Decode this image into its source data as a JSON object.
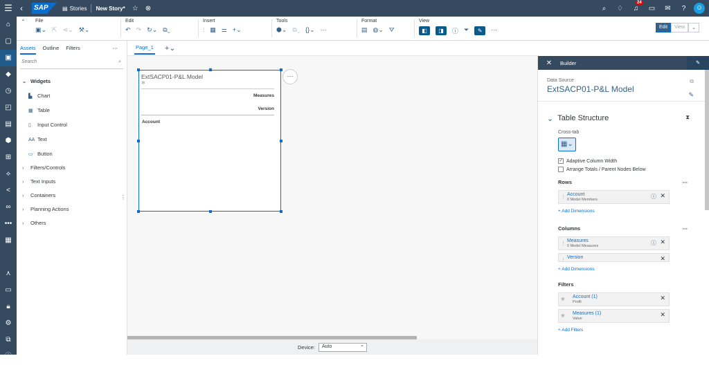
{
  "shell": {
    "logo": "SAP",
    "crumb_app": "Stories",
    "title": "New Story",
    "title_suffix": "*",
    "notification_count": "24"
  },
  "toolbar": {
    "groups": [
      {
        "label": "File"
      },
      {
        "label": "Edit"
      },
      {
        "label": "Insert"
      },
      {
        "label": "Tools"
      },
      {
        "label": "Format"
      },
      {
        "label": "View"
      }
    ],
    "mode_edit": "Edit",
    "mode_view": "View"
  },
  "assets": {
    "tabs": [
      "Assets",
      "Outline",
      "Filters"
    ],
    "search_placeholder": "Search",
    "widgets_label": "Widgets",
    "widgets": [
      "Chart",
      "Table",
      "Input Control",
      "Text",
      "Button"
    ],
    "groups": [
      "Filters/Controls",
      "Text Inputs",
      "Containers",
      "Planning Actions",
      "Others"
    ]
  },
  "canvas": {
    "page_tab": "Page_1",
    "widget_title": "ExtSACP01-P&L Model",
    "col_header_1": "Measures",
    "col_header_2": "Version",
    "row_header": "Account",
    "device_label": "Device:",
    "device_value": "Auto"
  },
  "builder": {
    "title": "Builder",
    "data_source_label": "Data Source",
    "data_source_value": "ExtSACP01-P&L Model",
    "table_structure": "Table Structure",
    "crosstab_label": "Cross-tab",
    "adaptive": "Adaptive Column Width",
    "arrange": "Arrange Totals / Parent Nodes Below",
    "rows_label": "Rows",
    "rows": [
      {
        "name": "Account",
        "sub": "0 Model Members"
      }
    ],
    "add_dimensions": "+ Add Dimensions",
    "columns_label": "Columns",
    "columns": [
      {
        "name": "Measures",
        "sub": "0 Model Measures"
      },
      {
        "name": "Version",
        "sub": ""
      }
    ],
    "filters_label": "Filters",
    "filters": [
      {
        "name": "Account (1)",
        "sub": "Profit"
      },
      {
        "name": "Measures (1)",
        "sub": "Value"
      }
    ],
    "add_filters": "+ Add Filters"
  }
}
